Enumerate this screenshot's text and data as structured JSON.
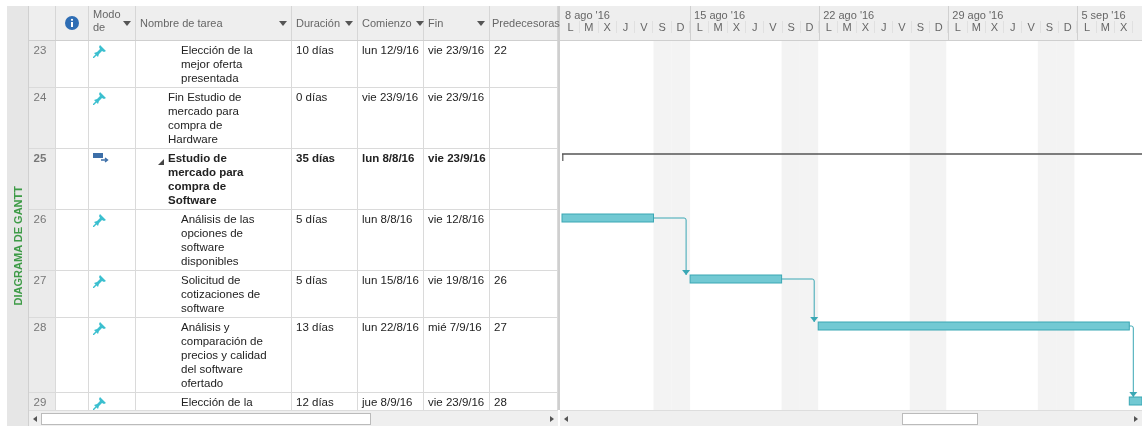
{
  "side_label": "DIAGRAMA DE GANTT",
  "table": {
    "columns": [
      {
        "kind": "info",
        "dropdown": false
      },
      {
        "label": "Modo de",
        "kind": "text",
        "dropdown": true
      },
      {
        "label": "Nombre de tarea",
        "kind": "text",
        "dropdown": true
      },
      {
        "label": "Duración",
        "kind": "text",
        "dropdown": true
      },
      {
        "label": "Comienzo",
        "kind": "text",
        "dropdown": true
      },
      {
        "label": "Fin",
        "kind": "text",
        "dropdown": true
      },
      {
        "label": "Predecesoras",
        "kind": "text",
        "dropdown": false
      }
    ],
    "rows": [
      {
        "children": [
          {
            "id": "23",
            "manually_scheduled": true,
            "kind": "task",
            "name": "Elección de la mejor oferta presentada",
            "duration": "10 días",
            "start": "lun 12/9/16",
            "finish": "vie 23/9/16",
            "predecessors": "22"
          }
        ]
      },
      {
        "id": "24",
        "manually_scheduled": true,
        "kind": "milestone",
        "name": "Fin Estudio de mercado para compra de Hardware",
        "duration": "0 días",
        "start": "vie 23/9/16",
        "finish": "vie 23/9/16"
      },
      {
        "id": "25",
        "manually_scheduled": false,
        "kind": "summary",
        "expanded": true,
        "name": "Estudio de mercado para compra de Software",
        "duration": "35 días",
        "start": "lun 8/8/16",
        "finish": "vie 23/9/16",
        "children": [
          {
            "id": "26",
            "manually_scheduled": true,
            "kind": "task",
            "name": "Análisis de las opciones de software disponibles",
            "duration": "5 días",
            "start": "lun 8/8/16",
            "finish": "vie 12/8/16"
          },
          {
            "id": "27",
            "manually_scheduled": true,
            "kind": "task",
            "name": "Solicitud de cotizaciones de software",
            "duration": "5 días",
            "start": "lun 15/8/16",
            "finish": "vie 19/8/16",
            "predecessors": "26"
          },
          {
            "id": "28",
            "manually_scheduled": true,
            "kind": "task",
            "name": "Análisis y comparación de precios y calidad del software ofertado",
            "duration": "13 días",
            "start": "lun 22/8/16",
            "finish": "mié 7/9/16",
            "predecessors": "27"
          },
          {
            "id": "29",
            "manually_scheduled": true,
            "kind": "task",
            "name": "Elección de la",
            "duration": "12 días",
            "start": "jue 8/9/16",
            "finish": "vie 23/9/16",
            "predecessors": "28"
          }
        ]
      }
    ]
  },
  "timeline": {
    "weeks": [
      {
        "label": "8 ago '16",
        "days": [
          "L",
          "M",
          "X",
          "J",
          "V",
          "S",
          "D"
        ]
      },
      {
        "label": "15 ago '16",
        "days": [
          "L",
          "M",
          "X",
          "J",
          "V",
          "S",
          "D"
        ]
      },
      {
        "label": "22 ago '16",
        "days": [
          "L",
          "M",
          "X",
          "J",
          "V",
          "S",
          "D"
        ]
      },
      {
        "label": "29 ago '16",
        "days": [
          "L",
          "M",
          "X",
          "J",
          "V",
          "S",
          "D"
        ]
      },
      {
        "label": "5 sep '16",
        "days": [
          "L",
          "M",
          "X"
        ]
      }
    ]
  }
}
